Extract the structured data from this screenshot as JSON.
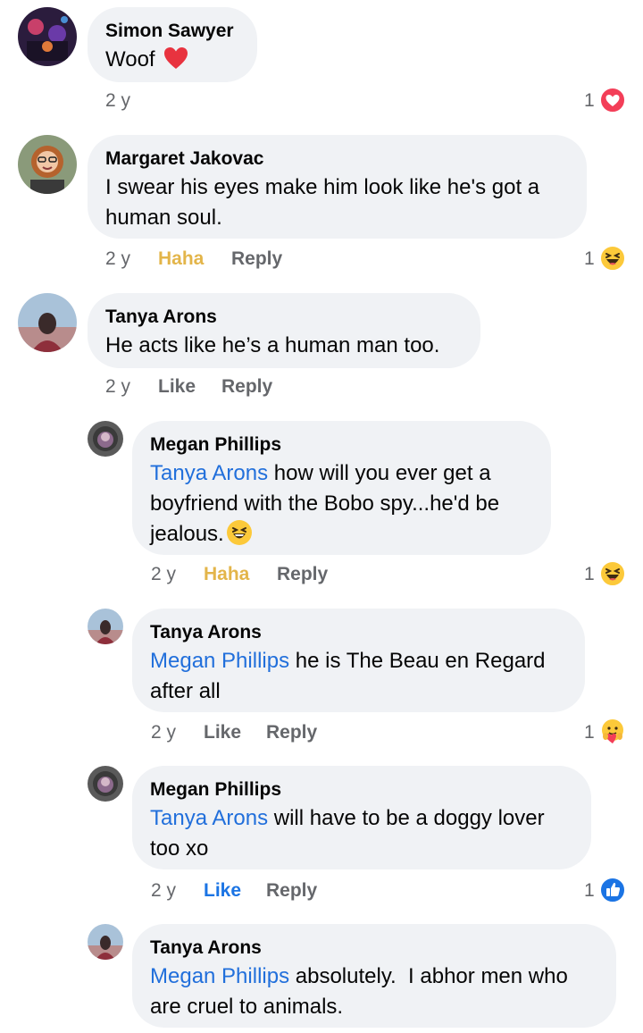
{
  "comments": [
    {
      "author": "Simon Sawyer",
      "text": "Woof",
      "time": "2 y",
      "reaction_count": "1",
      "reaction_icon": "love-reaction-icon",
      "inline_emoji": "red-heart-emoji"
    },
    {
      "author": "Margaret Jakovac",
      "text": "I swear his eyes make him look like he's got a human soul.",
      "time": "2 y",
      "action_1": "Haha",
      "action_2": "Reply",
      "reaction_count": "1",
      "reaction_icon": "haha-reaction-icon"
    },
    {
      "author": "Tanya Arons",
      "text": "He acts like he’s a human man too.",
      "time": "2 y",
      "action_1": "Like",
      "action_2": "Reply"
    }
  ],
  "replies": [
    {
      "author": "Megan Phillips",
      "mention": "Tanya Arons",
      "text": " how will you ever get a boyfriend with the Bobo spy...he'd be jealous.",
      "time": "2 y",
      "action_1": "Haha",
      "action_2": "Reply",
      "reaction_count": "1",
      "reaction_icon": "haha-reaction-icon",
      "inline_emoji": "grinning-squinting-emoji"
    },
    {
      "author": "Tanya Arons",
      "mention": "Megan Phillips",
      "text": " he is The Beau en Regard after all",
      "time": "2 y",
      "action_1": "Like",
      "action_2": "Reply",
      "reaction_count": "1",
      "reaction_icon": "care-reaction-icon"
    },
    {
      "author": "Megan Phillips",
      "mention": "Tanya Arons",
      "text": " will have to be a doggy lover too xo",
      "time": "2 y",
      "action_1": "Like",
      "action_2": "Reply",
      "reaction_count": "1",
      "reaction_icon": "like-reaction-icon"
    },
    {
      "author": "Tanya Arons",
      "mention": "Megan Phillips",
      "text": " absolutely.  I abhor men who are cruel to animals."
    }
  ],
  "colors": {
    "bubble": "#f0f2f5",
    "mention": "#216fdb",
    "haha": "#e3b54a",
    "like_active": "#1b74e4",
    "meta": "#65676b"
  }
}
